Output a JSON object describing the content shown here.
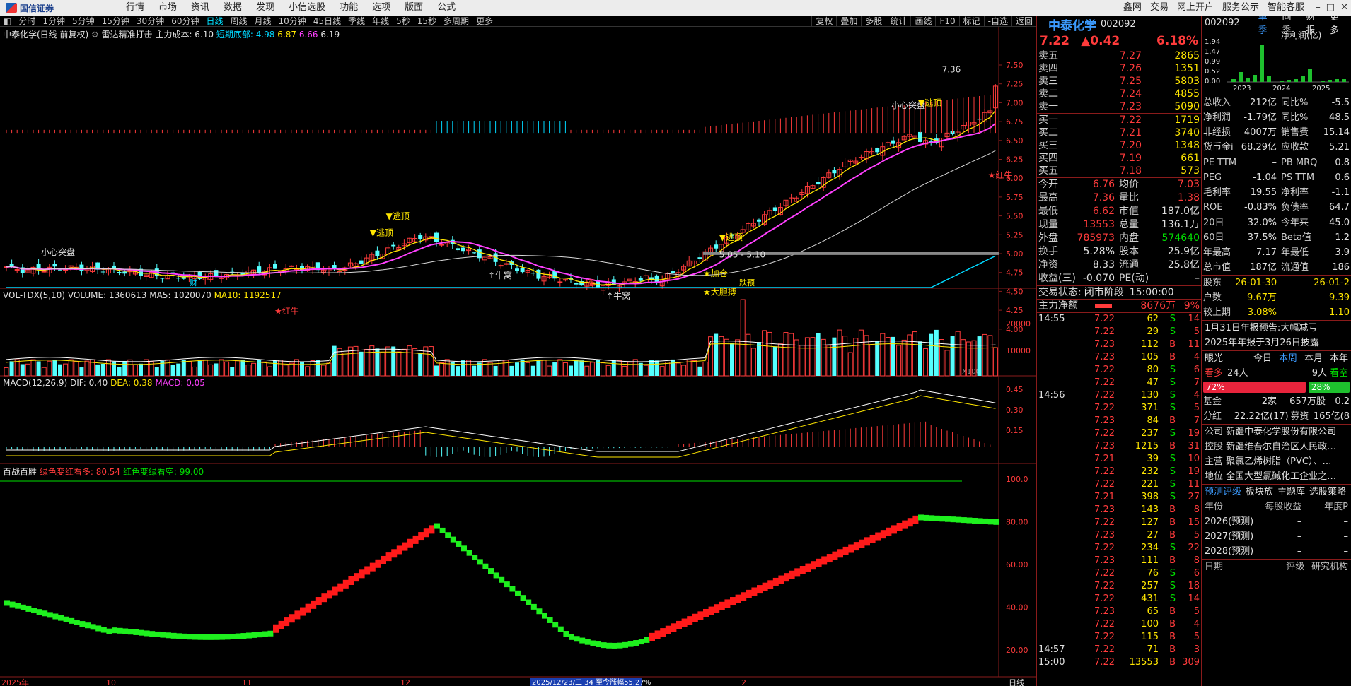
{
  "topbar": {
    "logo_text": "国信证券",
    "nav": [
      "行情",
      "市场",
      "资讯",
      "数据",
      "发现",
      "小信选股",
      "功能",
      "选项",
      "版面",
      "公式"
    ],
    "right": [
      "鑫网",
      "交易",
      "网上开户",
      "服务公示",
      "智能客服"
    ]
  },
  "periods": [
    "分时",
    "1分钟",
    "5分钟",
    "15分钟",
    "30分钟",
    "60分钟",
    "日线",
    "周线",
    "月线",
    "10分钟",
    "45日线",
    "季线",
    "年线",
    "5秒",
    "15秒",
    "多周期",
    "更多"
  ],
  "period_active": "日线",
  "period_right": [
    "复权",
    "叠加",
    "多股",
    "统计",
    "画线",
    "F10",
    "标记",
    "-自选",
    "返回"
  ],
  "main_info": {
    "title": "中泰化学(日线 前复权)",
    "indicator": "雷达精准打击",
    "cost": "主力成本: 6.10",
    "cost2": "短期底部: 4.98",
    "v1": "6.87",
    "v2": "6.66",
    "v3": "6.19"
  },
  "price_axis": [
    "7.50",
    "7.25",
    "7.00",
    "6.75",
    "6.50",
    "6.25",
    "6.00",
    "5.75",
    "5.50",
    "5.25",
    "5.00",
    "4.75",
    "4.50",
    "4.25",
    "4.00"
  ],
  "annotations": {
    "high": "7.36",
    "range": "5.05 - 5.10",
    "small_heart1": "小心突盘",
    "small_heart2": "小心突盘",
    "escape1": "▼逃顶",
    "escape2": "▼逃顶",
    "escape3": "▼逃顶",
    "escape4": "▼逃顶",
    "red_bull1": "★红牛",
    "red_bull2": "★红牛",
    "add": "★加仓",
    "bold": "★大胆搏",
    "bull1": "↑牛窝",
    "bull2": "↑牛窝",
    "fin": "财",
    "zhang": "涨",
    "jieyu": "跌预"
  },
  "vol_info": {
    "title": "VOL-TDX(5,10)",
    "volume": "VOLUME: 1360613",
    "ma5": "MA5: 1020070",
    "ma10": "MA10: 1192517"
  },
  "vol_axis": [
    "20000",
    "10000"
  ],
  "vol_unit": "X100",
  "macd_info": {
    "title": "MACD(12,26,9)",
    "dif": "DIF: 0.40",
    "dea": "DEA: 0.38",
    "macd": "MACD: 0.05"
  },
  "macd_axis": [
    "0.45",
    "0.30",
    "0.15"
  ],
  "bz_info": {
    "title": "百战百胜",
    "g": "绿色变红看多: 80.54",
    "r": "红色变绿看空: 99.00"
  },
  "bz_axis": [
    "100.0",
    "80.00",
    "60.00",
    "40.00",
    "20.00"
  ],
  "date_axis": [
    "2025年",
    "10",
    "11",
    "12",
    "1",
    "2"
  ],
  "date_tip": "2025/12/23/二 34 至今涨幅55.27%",
  "date_right": "日线",
  "quote": {
    "name": "中泰化学",
    "code": "002092",
    "price": "7.22",
    "change": "▲0.42",
    "pct": "6.18%",
    "asks": [
      {
        "label": "卖五",
        "price": "7.27",
        "vol": "2865"
      },
      {
        "label": "卖四",
        "price": "7.26",
        "vol": "1351"
      },
      {
        "label": "卖三",
        "price": "7.25",
        "vol": "5803"
      },
      {
        "label": "卖二",
        "price": "7.24",
        "vol": "4855"
      },
      {
        "label": "卖一",
        "price": "7.23",
        "vol": "5090"
      }
    ],
    "bids": [
      {
        "label": "买一",
        "price": "7.22",
        "vol": "1719"
      },
      {
        "label": "买二",
        "price": "7.21",
        "vol": "3740"
      },
      {
        "label": "买三",
        "price": "7.20",
        "vol": "1348"
      },
      {
        "label": "买四",
        "price": "7.19",
        "vol": "661"
      },
      {
        "label": "买五",
        "price": "7.18",
        "vol": "573"
      }
    ],
    "stats": [
      {
        "l1": "今开",
        "v1": "6.76",
        "c1": "red",
        "l2": "均价",
        "v2": "7.03",
        "c2": "red"
      },
      {
        "l1": "最高",
        "v1": "7.36",
        "c1": "red",
        "l2": "量比",
        "v2": "1.38",
        "c2": "red"
      },
      {
        "l1": "最低",
        "v1": "6.62",
        "c1": "red",
        "l2": "市值",
        "v2": "187.0亿",
        "c2": "wht"
      },
      {
        "l1": "现量",
        "v1": "13553",
        "c1": "red",
        "l2": "总量",
        "v2": "136.1万",
        "c2": "wht"
      },
      {
        "l1": "外盘",
        "v1": "785973",
        "c1": "red",
        "l2": "内盘",
        "v2": "574640",
        "c2": "grn"
      },
      {
        "l1": "换手",
        "v1": "5.28%",
        "c1": "wht",
        "l2": "股本",
        "v2": "25.9亿",
        "c2": "wht"
      },
      {
        "l1": "净资",
        "v1": "8.33",
        "c1": "wht",
        "l2": "流通",
        "v2": "25.8亿",
        "c2": "wht"
      },
      {
        "l1": "收益(三)",
        "v1": "-0.070",
        "c1": "wht",
        "l2": "PE(动)",
        "v2": "–",
        "c2": "wht"
      }
    ],
    "trade_state_label": "交易状态:",
    "trade_state": "闭市阶段",
    "trade_time": "15:00:00",
    "main_net_label": "主力净额",
    "main_net": "8676万",
    "main_net_pct": "9%",
    "ticks": [
      {
        "t": "14:55",
        "p": "7.22",
        "v": "62",
        "d": "S",
        "n": "14"
      },
      {
        "t": "",
        "p": "7.22",
        "v": "29",
        "d": "S",
        "n": "5"
      },
      {
        "t": "",
        "p": "7.23",
        "v": "112",
        "d": "B",
        "n": "11"
      },
      {
        "t": "",
        "p": "7.23",
        "v": "105",
        "d": "B",
        "n": "4"
      },
      {
        "t": "",
        "p": "7.22",
        "v": "80",
        "d": "S",
        "n": "6"
      },
      {
        "t": "",
        "p": "7.22",
        "v": "47",
        "d": "S",
        "n": "7"
      },
      {
        "t": "14:56",
        "p": "7.22",
        "v": "130",
        "d": "S",
        "n": "4"
      },
      {
        "t": "",
        "p": "7.22",
        "v": "371",
        "d": "S",
        "n": "5"
      },
      {
        "t": "",
        "p": "7.23",
        "v": "84",
        "d": "B",
        "n": "7"
      },
      {
        "t": "",
        "p": "7.22",
        "v": "237",
        "d": "S",
        "n": "19"
      },
      {
        "t": "",
        "p": "7.23",
        "v": "1215",
        "d": "B",
        "n": "31"
      },
      {
        "t": "",
        "p": "7.21",
        "v": "39",
        "d": "S",
        "n": "10"
      },
      {
        "t": "",
        "p": "7.22",
        "v": "232",
        "d": "S",
        "n": "19"
      },
      {
        "t": "",
        "p": "7.22",
        "v": "221",
        "d": "S",
        "n": "11"
      },
      {
        "t": "",
        "p": "7.21",
        "v": "398",
        "d": "S",
        "n": "27"
      },
      {
        "t": "",
        "p": "7.23",
        "v": "143",
        "d": "B",
        "n": "8"
      },
      {
        "t": "",
        "p": "7.22",
        "v": "127",
        "d": "B",
        "n": "15"
      },
      {
        "t": "",
        "p": "7.23",
        "v": "27",
        "d": "B",
        "n": "5"
      },
      {
        "t": "",
        "p": "7.22",
        "v": "234",
        "d": "S",
        "n": "22"
      },
      {
        "t": "",
        "p": "7.23",
        "v": "111",
        "d": "B",
        "n": "8"
      },
      {
        "t": "",
        "p": "7.22",
        "v": "76",
        "d": "S",
        "n": "6"
      },
      {
        "t": "",
        "p": "7.22",
        "v": "257",
        "d": "S",
        "n": "18"
      },
      {
        "t": "",
        "p": "7.22",
        "v": "431",
        "d": "S",
        "n": "14"
      },
      {
        "t": "",
        "p": "7.23",
        "v": "65",
        "d": "B",
        "n": "5"
      },
      {
        "t": "",
        "p": "7.22",
        "v": "100",
        "d": "B",
        "n": "4"
      },
      {
        "t": "",
        "p": "7.22",
        "v": "115",
        "d": "B",
        "n": "5"
      },
      {
        "t": "14:57",
        "p": "7.22",
        "v": "71",
        "d": "B",
        "n": "3"
      },
      {
        "t": "15:00",
        "p": "7.22",
        "v": "13553",
        "d": "B",
        "n": "309"
      }
    ]
  },
  "fpanel": {
    "code": "002092",
    "tabs": [
      "单季",
      "同季",
      "财报",
      "更多"
    ],
    "chart_title": "净利润(亿)",
    "chart_yaxis": [
      "1.94",
      "1.47",
      "0.99",
      "0.52",
      "0.00"
    ],
    "chart_years": [
      "2023",
      "2024",
      "2025"
    ],
    "fin": [
      {
        "k": "总收入",
        "v": "212亿",
        "k2": "同比%",
        "v2": "-5.5"
      },
      {
        "k": "净利润",
        "v": "-1.79亿",
        "k2": "同比%",
        "v2": "48.5"
      },
      {
        "k": "非经损",
        "v": "4007万",
        "k2": "销售费",
        "v2": "15.14"
      },
      {
        "k": "货币金i",
        "v": "68.29亿",
        "k2": "应收款",
        "v2": "5.21"
      }
    ],
    "val": [
      {
        "k": "PE TTM",
        "v": "–",
        "k2": "PB MRQ",
        "v2": "0.8"
      },
      {
        "k": "PEG",
        "v": "-1.04",
        "k2": "PS TTM",
        "v2": "0.6"
      },
      {
        "k": "毛利率",
        "v": "19.55",
        "k2": "净利率",
        "v2": "-1.1"
      },
      {
        "k": "ROE",
        "v": "-0.83%",
        "k2": "负债率",
        "v2": "64.7"
      }
    ],
    "perf": [
      {
        "k": "20日",
        "v": "32.0%",
        "k2": "今年来",
        "v2": "45.0"
      },
      {
        "k": "60日",
        "v": "37.5%",
        "k2": "Beta值",
        "v2": "1.2"
      },
      {
        "k": "年最高",
        "v": "7.17",
        "k2": "年最低",
        "v2": "3.9"
      },
      {
        "k": "总市值",
        "v": "187亿",
        "k2": "流通值",
        "v2": "186"
      }
    ],
    "holders": [
      {
        "k": "股东",
        "v": "26-01-30",
        "k2": "",
        "v2": "26-01-2"
      },
      {
        "k": "户数",
        "v": "9.67万",
        "k2": "",
        "v2": "9.39"
      },
      {
        "k": "较上期",
        "v": "3.08%",
        "k2": "",
        "v2": "1.10"
      }
    ],
    "notice1": "1月31日年报预告:大幅减亏",
    "notice2": "2025年年报于3月26日披露",
    "eye_label": "眼光",
    "eye_tabs": [
      "今日",
      "本周",
      "本月",
      "本年"
    ],
    "bull_label": "看多",
    "bull_count": "24人",
    "bear_count": "9人",
    "bear_label": "看空",
    "bull_pct": "72%",
    "bear_pct": "28%",
    "fund": {
      "k": "基金",
      "v": "2家",
      "v2": "657万股",
      "v3": "0.2"
    },
    "div": {
      "k": "分红",
      "v": "22.22亿(17)",
      "k2": "募资",
      "v2": "165亿(8"
    },
    "company_k": "公司",
    "company": "新疆中泰化学股份有限公司",
    "ctrl_k": "控股",
    "ctrl": "新疆维吾尔自治区人民政…",
    "biz_k": "主营",
    "biz": "聚氯乙烯树脂（PVC）、…",
    "pos_k": "地位",
    "pos": "全国大型氯碱化工企业之…",
    "fc_tabs": [
      "预测评级",
      "板块族",
      "主题库",
      "选股策略"
    ],
    "fc_head": [
      "年份",
      "每股收益",
      "年度P"
    ],
    "fc_rows": [
      {
        "y": "2026(预测)",
        "a": "–",
        "b": "–"
      },
      {
        "y": "2027(预测)",
        "a": "–",
        "b": "–"
      },
      {
        "y": "2028(预测)",
        "a": "–",
        "b": "–"
      }
    ],
    "rate_head": [
      "日期",
      "评级",
      "研究机构"
    ]
  }
}
